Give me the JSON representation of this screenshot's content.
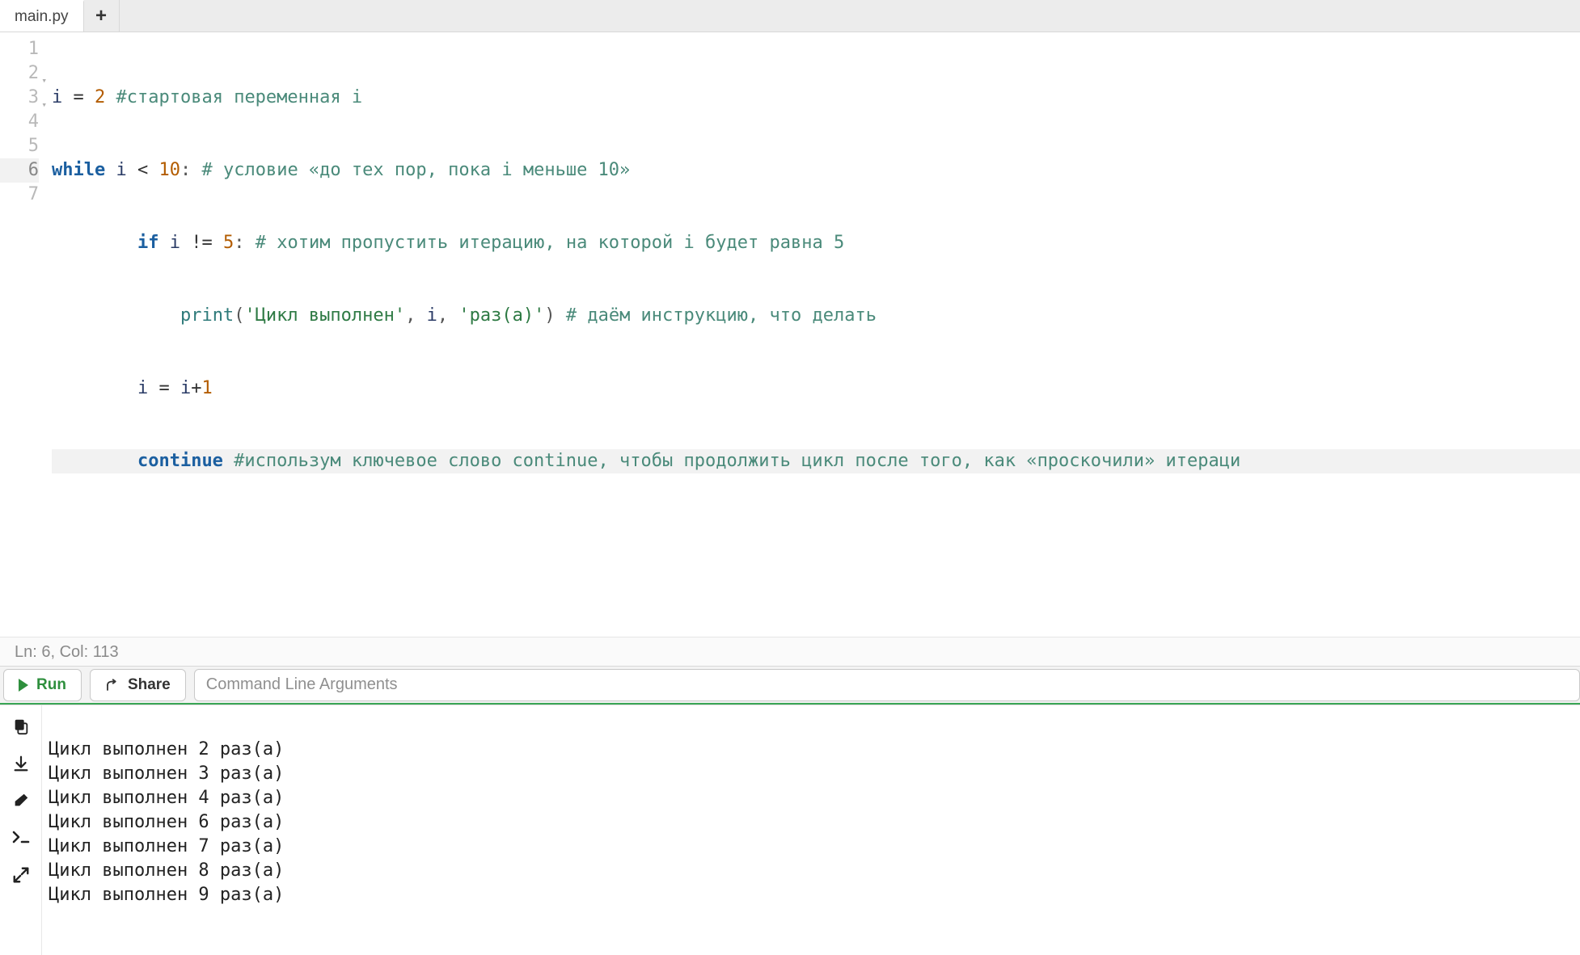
{
  "tabs": {
    "items": [
      {
        "label": "main.py",
        "active": true
      }
    ],
    "add_tooltip": "New Tab"
  },
  "editor": {
    "gutter": [
      {
        "n": "1",
        "fold": false
      },
      {
        "n": "2",
        "fold": true
      },
      {
        "n": "3",
        "fold": true
      },
      {
        "n": "4",
        "fold": false
      },
      {
        "n": "5",
        "fold": false
      },
      {
        "n": "6",
        "fold": false,
        "active": true
      },
      {
        "n": "7",
        "fold": false
      }
    ],
    "lines": {
      "l1": {
        "ident": "i",
        "op": "=",
        "num": "2",
        "comment": "#стартовая переменная i"
      },
      "l2": {
        "kw": "while",
        "ident": "i",
        "op": "<",
        "num": "10",
        "colon": ":",
        "comment": "# условие «до тех пор, пока i меньше 10»"
      },
      "l3": {
        "indent": "        ",
        "kw": "if",
        "ident": "i",
        "op": "!=",
        "num": "5",
        "colon": ":",
        "comment": "# хотим пропустить итерацию, на которой i будет равна 5"
      },
      "l4": {
        "indent": "            ",
        "builtin": "print",
        "lp": "(",
        "str1": "'Цикл выполнен'",
        "comma1": ", ",
        "ident": "i",
        "comma2": ", ",
        "str2": "'раз(а)'",
        "rp": ")",
        "comment": " # даём инструкцию, что делать"
      },
      "l5": {
        "indent": "        ",
        "ident": "i",
        "op1": "=",
        "ident2": "i",
        "op2": "+",
        "num": "1"
      },
      "l6": {
        "indent": "        ",
        "kw": "continue",
        "comment": " #использум ключевое слово continue, чтобы продолжить цикл после того, как «проскочили» итераци"
      }
    }
  },
  "status": {
    "text": "Ln: 6,  Col: 113",
    "line": 6,
    "col": 113
  },
  "toolbar": {
    "run_label": "Run",
    "share_label": "Share",
    "cli_placeholder": "Command Line Arguments"
  },
  "output": {
    "lines": [
      "Цикл выполнен 2 раз(а)",
      "Цикл выполнен 3 раз(а)",
      "Цикл выполнен 4 раз(а)",
      "Цикл выполнен 6 раз(а)",
      "Цикл выполнен 7 раз(а)",
      "Цикл выполнен 8 раз(а)",
      "Цикл выполнен 9 раз(а)"
    ]
  },
  "sidebar_icons": {
    "copy": "copy-icon",
    "download": "download-icon",
    "eraser": "eraser-icon",
    "terminal": "terminal-icon",
    "expand": "expand-icon"
  }
}
